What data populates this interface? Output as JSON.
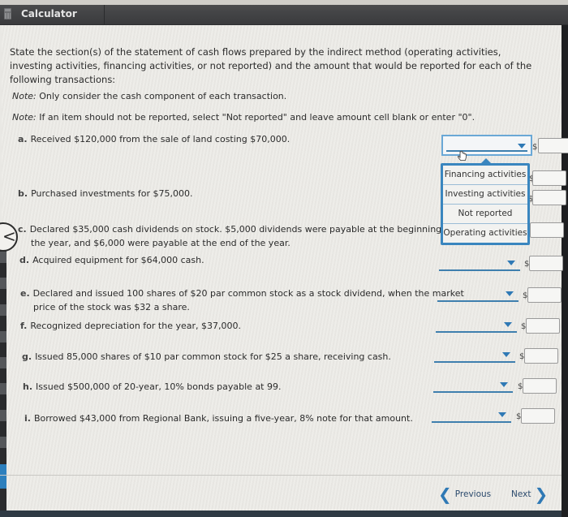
{
  "window": {
    "title": "Calculator",
    "icon": "calculator-icon"
  },
  "question": {
    "prompt": "State the section(s) of the statement of cash flows prepared by the indirect method (operating activities, investing activities, financing activities, or not reported) and the amount that would be reported for each of the following transactions:",
    "note1_label": "Note:",
    "note1_text": " Only consider the cash component of each transaction.",
    "note2_label": "Note:",
    "note2_text": " If an item should not be reported, select \"Not reported\" and leave amount cell blank or enter \"0\"."
  },
  "items": [
    {
      "letter": "a.",
      "line1": "Received $120,000 from the sale of land costing $70,000.",
      "line2": "",
      "section": "",
      "amount": ""
    },
    {
      "letter": "b.",
      "line1": "Purchased investments for $75,000.",
      "line2": "",
      "section": "",
      "amount": ""
    },
    {
      "letter": "c.",
      "line1": "Declared $35,000 cash dividends on stock. $5,000 dividends were payable at the beginning of",
      "line2": "the year, and $6,000 were payable at the end of the year.",
      "section": "",
      "amount": ""
    },
    {
      "letter": "d.",
      "line1": "Acquired equipment for $64,000 cash.",
      "line2": "",
      "section": "",
      "amount": ""
    },
    {
      "letter": "e.",
      "line1": "Declared and issued 100 shares of $20 par common stock as a stock dividend, when the market",
      "line2": "price of the stock was $32 a share.",
      "section": "",
      "amount": ""
    },
    {
      "letter": "f.",
      "line1": "Recognized depreciation for the year, $37,000.",
      "line2": "",
      "section": "",
      "amount": ""
    },
    {
      "letter": "g.",
      "line1": "Issued 85,000 shares of $10 par common stock for $25 a share, receiving cash.",
      "line2": "",
      "section": "",
      "amount": ""
    },
    {
      "letter": "h.",
      "line1": "Issued $500,000 of 20-year, 10% bonds payable at 99.",
      "line2": "",
      "section": "",
      "amount": ""
    },
    {
      "letter": "i.",
      "line1": "Borrowed $43,000 from Regional Bank, issuing a five-year, 8% note for that amount.",
      "line2": "",
      "section": "",
      "amount": ""
    }
  ],
  "currency_symbol": "$",
  "dropdown_open": {
    "for_item": "a.",
    "options": [
      "Financing activities",
      "Investing activities",
      "Not reported",
      "Operating activities"
    ]
  },
  "navigation": {
    "previous_label": "Previous",
    "next_label": "Next"
  },
  "colors": {
    "accent": "#2f79b5",
    "titlebar": "#3f4042"
  }
}
